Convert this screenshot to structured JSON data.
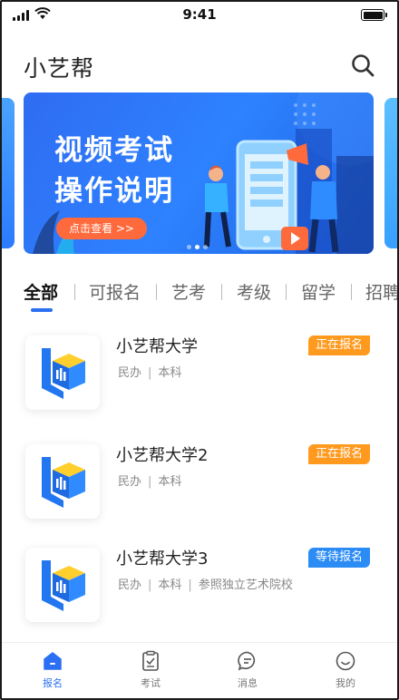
{
  "status_bar": {
    "time": "9:41"
  },
  "header": {
    "title": "小艺帮",
    "search_icon": "search-icon"
  },
  "banner": {
    "title_line1": "视频考试",
    "title_line2": "操作说明",
    "cta": "点击查看 >>",
    "slide_count": 3,
    "active_slide": 1
  },
  "tabs": [
    {
      "label": "全部",
      "active": true
    },
    {
      "label": "可报名",
      "active": false
    },
    {
      "label": "艺考",
      "active": false
    },
    {
      "label": "考级",
      "active": false
    },
    {
      "label": "留学",
      "active": false
    },
    {
      "label": "招聘",
      "active": false
    }
  ],
  "universities": [
    {
      "name": "小艺帮大学",
      "meta": [
        "民办",
        "本科"
      ],
      "badge": "正在报名",
      "badge_color": "#ff9a1f"
    },
    {
      "name": "小艺帮大学2",
      "meta": [
        "民办",
        "本科"
      ],
      "badge": "正在报名",
      "badge_color": "#ff9a1f"
    },
    {
      "name": "小艺帮大学3",
      "meta": [
        "民办",
        "本科",
        "参照独立艺术院校"
      ],
      "badge": "等待报名",
      "badge_color": "#2b8cf5"
    }
  ],
  "bottom_nav": [
    {
      "label": "报名",
      "icon": "home-icon",
      "active": true
    },
    {
      "label": "考试",
      "icon": "exam-clipboard-icon",
      "active": false
    },
    {
      "label": "消息",
      "icon": "message-bubble-icon",
      "active": false
    },
    {
      "label": "我的",
      "icon": "smiley-profile-icon",
      "active": false
    }
  ],
  "colors": {
    "accent": "#2b6ff2",
    "registering": "#ff9a1f",
    "waiting": "#2b8cf5",
    "cta": "#ff6a3d"
  }
}
